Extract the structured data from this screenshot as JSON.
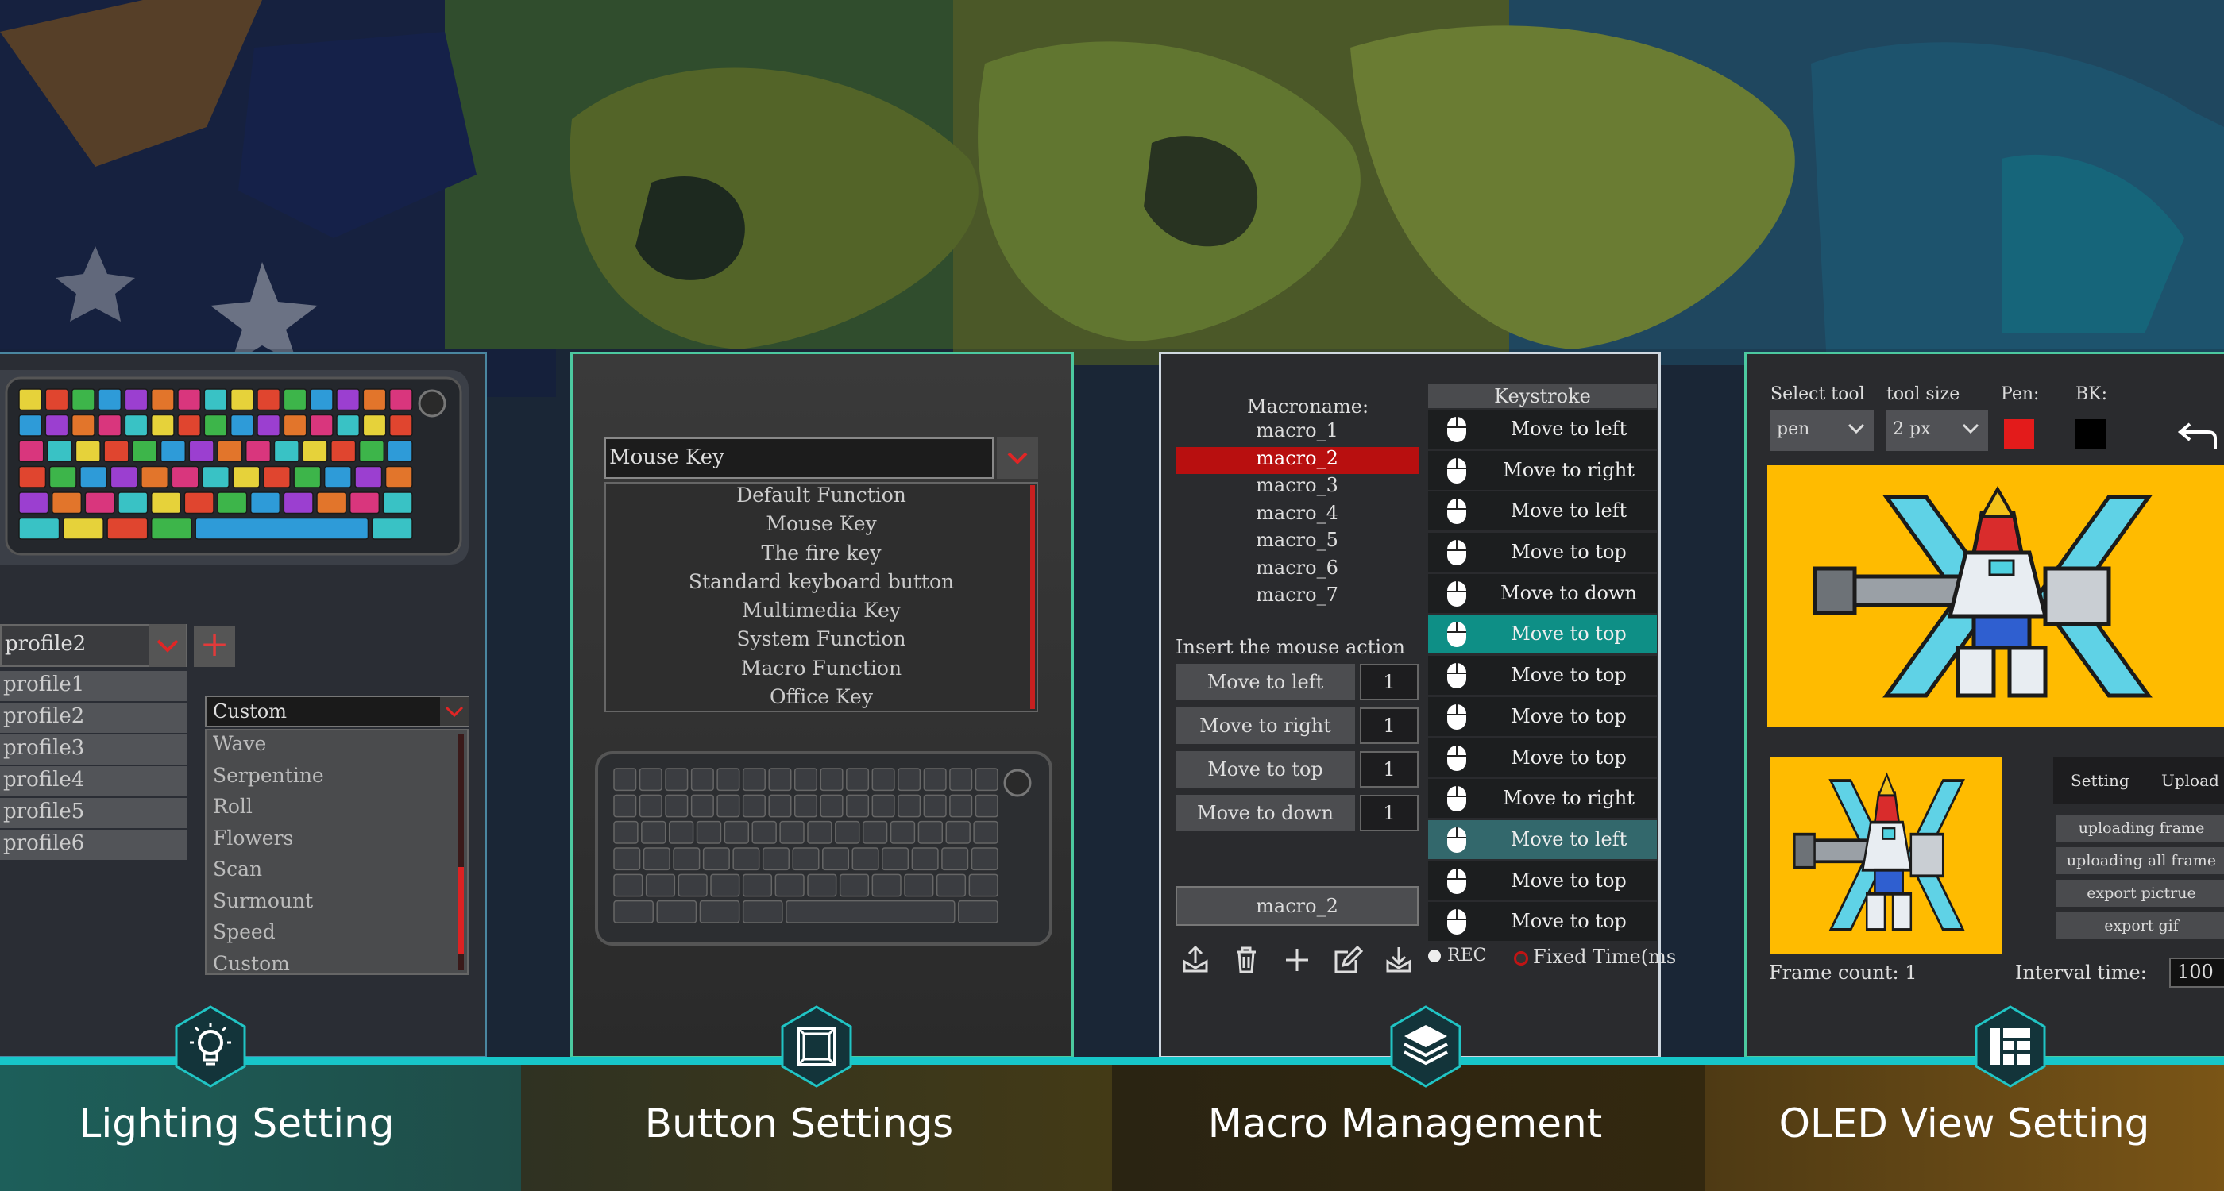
{
  "colors": {
    "accent_cyan": "#17c6c9",
    "selection_red": "#b80f0f",
    "keystroke_highlight": "#0e8f86",
    "oled_bg": "#ffbb00",
    "pen_color": "#e31b1b",
    "bk_color": "#000000"
  },
  "lighting": {
    "profile_selected": "profile2",
    "profiles": [
      "profile1",
      "profile2",
      "profile3",
      "profile4",
      "profile5",
      "profile6"
    ],
    "effect_selected": "Custom",
    "effects": [
      "Wave",
      "Serpentine",
      "Roll",
      "Flowers",
      "Scan",
      "Surmount",
      "Speed",
      "Custom"
    ]
  },
  "button": {
    "selected": "Mouse Key",
    "options": [
      "Default Function",
      "Mouse Key",
      "The fire key",
      "Standard keyboard button",
      "Multimedia Key",
      "System Function",
      "Macro Function",
      "Office Key"
    ]
  },
  "macro": {
    "macroname_label": "Macroname:",
    "macros": [
      "macro_1",
      "macro_2",
      "macro_3",
      "macro_4",
      "macro_5",
      "macro_6",
      "macro_7"
    ],
    "selected_macro": "macro_2",
    "insert_label": "Insert the mouse action",
    "actions": [
      {
        "name": "Move to left",
        "count": "1"
      },
      {
        "name": "Move to right",
        "count": "1"
      },
      {
        "name": "Move to top",
        "count": "1"
      },
      {
        "name": "Move to down",
        "count": "1"
      }
    ],
    "name_box": "macro_2",
    "keystroke_header": "Keystroke",
    "keystrokes": [
      "Move to left",
      "Move to right",
      "Move to left",
      "Move to top",
      "Move to down",
      "Move to top",
      "Move to top",
      "Move to top",
      "Move to top",
      "Move to right",
      "Move to left",
      "Move to top",
      "Move to top"
    ],
    "rec_label": "REC",
    "fixed_label": "Fixed Time(ms"
  },
  "oled": {
    "select_tool_label": "Select tool",
    "tool_size_label": "tool size",
    "pen_label": "Pen:",
    "bk_label": "BK:",
    "tool_value": "pen",
    "size_value": "2 px",
    "setting_label": "Setting",
    "upload_label": "Upload",
    "buttons": [
      "uploading frame",
      "uploading all frame",
      "export pictrue",
      "export gif"
    ],
    "frame_count_label": "Frame count:",
    "frame_count_value": "1",
    "interval_label": "Interval time:",
    "interval_value": "100"
  },
  "tabs": [
    {
      "label": "Lighting Setting",
      "icon": "lightbulb-icon",
      "color": "#1d5f5a"
    },
    {
      "label": "Button Settings",
      "icon": "square-frame-icon",
      "color": "#3a3414"
    },
    {
      "label": "Macro Management",
      "icon": "layers-icon",
      "color": "#2c2410"
    },
    {
      "label": "OLED View Setting",
      "icon": "dashboard-layout-icon",
      "color": "#6b4a12"
    }
  ]
}
